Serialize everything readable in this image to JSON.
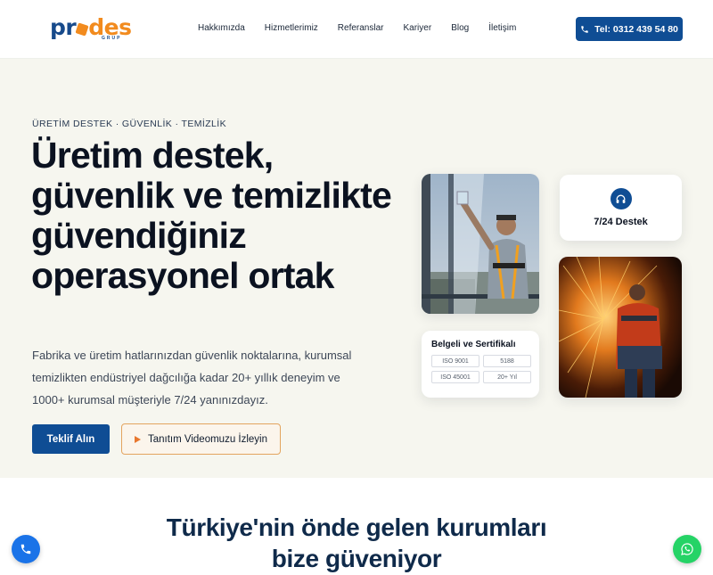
{
  "brand": {
    "name_left": "pr",
    "name_right": "des",
    "sub": "GRUP"
  },
  "nav": {
    "items": [
      "Hakkımızda",
      "Hizmetlerimiz",
      "Referanslar",
      "Kariyer",
      "Blog",
      "İletişim"
    ]
  },
  "header": {
    "phone_label": "Tel: 0312 439 54 80"
  },
  "hero": {
    "kicker": "ÜRETİM DESTEK · GÜVENLİK · TEMİZLİK",
    "title": "Üretim destek, güvenlik ve temizlikte güvendiğiniz operasyonel ortak",
    "description": "Fabrika ve üretim hatlarınızdan güvenlik noktalarına, kurumsal temizlikten endüstriyel dağcılığa kadar 20+ yıllık deneyim ve 1000+ kurumsal müşteriyle 7/24 yanınızdayız.",
    "primary_button": "Teklif Alın",
    "video_button": "Tanıtım Videomuzu İzleyin"
  },
  "cards": {
    "support_label": "7/24 Destek",
    "certs_title": "Belgeli ve Sertifikalı",
    "certs": [
      "ISO 9001",
      "5188",
      "ISO 45001",
      "20+ Yıl"
    ]
  },
  "trust": {
    "title_line1": "Türkiye'nin önde gelen kurumları",
    "title_line2": "bize güveniyor"
  },
  "colors": {
    "primary": "#0f4d94",
    "accent": "#f28b1e",
    "hero_bg": "#f6f6ef",
    "whatsapp": "#25d366"
  },
  "icons": {
    "phone": "phone-icon",
    "headset": "headset-icon",
    "play": "play-icon",
    "whatsapp": "whatsapp-icon"
  }
}
